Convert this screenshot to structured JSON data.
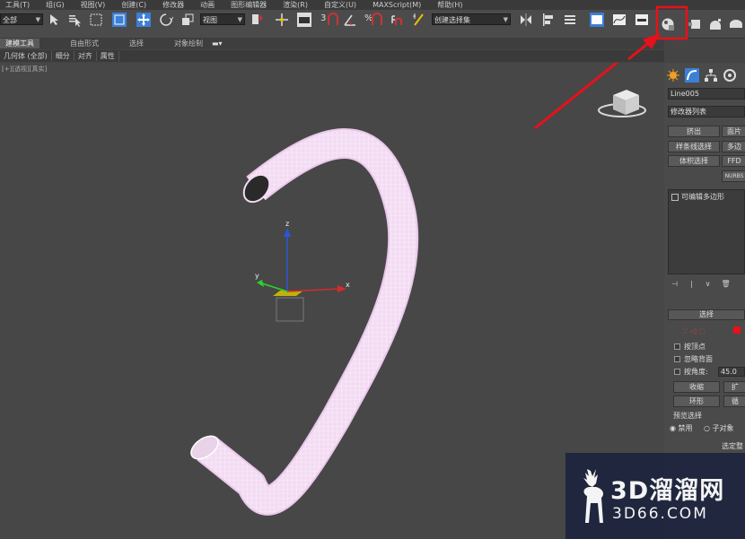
{
  "menu": [
    "工具(T)",
    "组(G)",
    "视图(V)",
    "创建(C)",
    "修改器",
    "动画",
    "图形编辑器",
    "渲染(R)",
    "自定义(U)",
    "MAXScript(M)",
    "帮助(H)"
  ],
  "toolbar": {
    "selection_filter": "全部",
    "ref_coord": "视图",
    "named_selection": "创建选择集",
    "snap_labels": [
      "3",
      "%"
    ]
  },
  "ribbon_tabs": [
    "建模工具",
    "自由形式",
    "选择",
    "对象绘制"
  ],
  "sub_tabs": [
    "几何体 (全部)",
    "细分",
    "对齐",
    "属性"
  ],
  "viewport": {
    "label": "[+][透视][真实]"
  },
  "axis": {
    "x": "x",
    "y": "y",
    "z": "z"
  },
  "panel": {
    "object_name": "Line005",
    "modifier_list": "修改器列表",
    "buttons": [
      "挤出",
      "面片",
      "样条线选择",
      "多边",
      "体积选择",
      "FFD",
      "NURBS"
    ],
    "stack_item": "可编辑多边形",
    "selection_rollout": "选择",
    "checkboxes": [
      "按顶点",
      "忽略背面",
      "按角度:"
    ],
    "angle_value": "45.0",
    "shrink": "收缩",
    "grow": "扩",
    "ring": "环形",
    "loop": "循",
    "preview_label": "预览选择",
    "preview_options": [
      "禁用",
      "子对象"
    ],
    "selected": "选定整"
  },
  "watermark": {
    "big": "3D溜溜网",
    "small": "3D66.COM"
  },
  "colors": {
    "highlight": "#e8101a",
    "tube": "#f3dcf3",
    "accent": "#3b7fd6"
  }
}
